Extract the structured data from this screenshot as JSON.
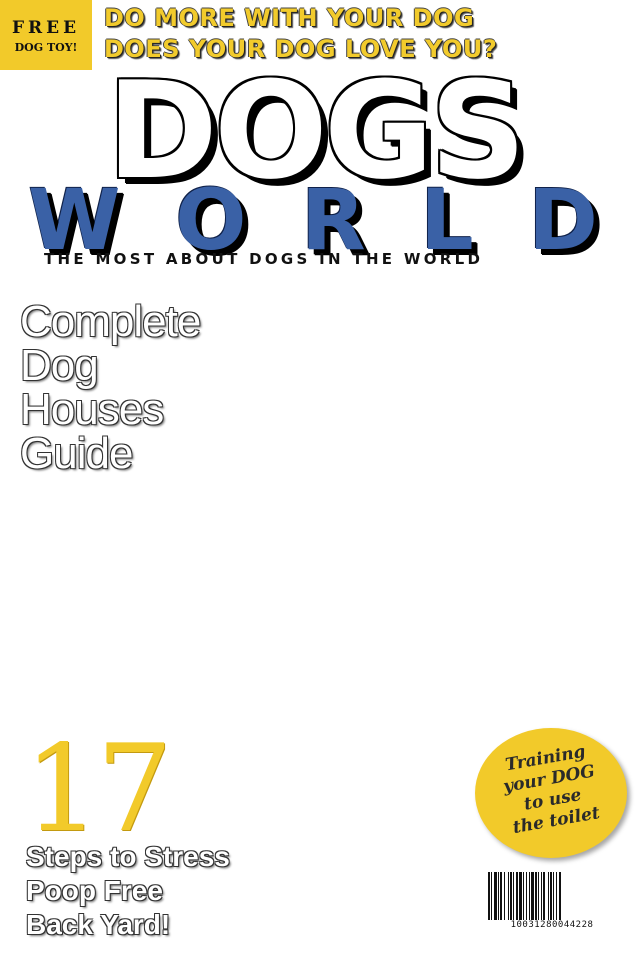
{
  "badge": {
    "line1": "FREE",
    "line2": "DOG TOY!"
  },
  "teasers": [
    "DO MORE WITH YOUR DOG",
    "DOES YOUR DOG LOVE YOU?"
  ],
  "logo": {
    "top": "DOGS",
    "bottom_letters": [
      "W",
      "O",
      "R",
      "L",
      "D"
    ],
    "tagline": "THE MOST ABOUT DOGS IN THE WORLD"
  },
  "feature": {
    "lines": [
      "Complete",
      "Dog",
      "Houses",
      "Guide"
    ]
  },
  "story": {
    "number": "17",
    "lines": [
      "Steps to Stress",
      "Poop Free",
      "Back Yard!"
    ]
  },
  "bubble": {
    "lines": [
      "Training",
      "your DOG",
      "to use",
      "the toilet"
    ]
  },
  "barcode": {
    "number": "10031280044228"
  },
  "colors": {
    "yellow": "#f2ca2a",
    "blue": "#3a61a6",
    "black": "#000000",
    "white": "#ffffff"
  }
}
